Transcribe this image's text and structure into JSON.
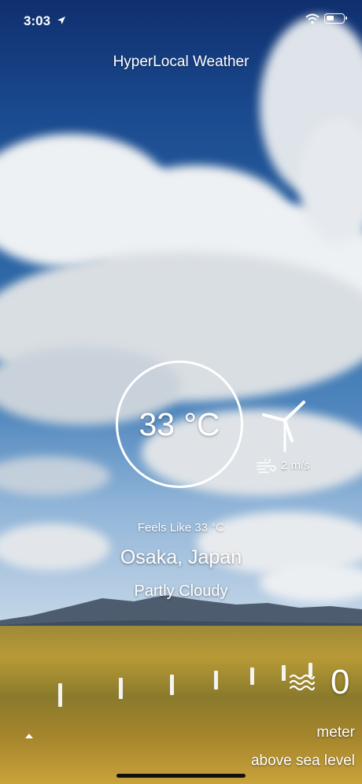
{
  "status_bar": {
    "time": "3:03"
  },
  "app": {
    "title": "HyperLocal Weather"
  },
  "weather": {
    "temperature": "33 °C",
    "wind_speed": "2 m/s",
    "feels_like": "Feels Like 33  °C",
    "location": "Osaka, Japan",
    "condition": "Partly Cloudy"
  },
  "elevation": {
    "value": "0",
    "unit": "meter",
    "reference": "above sea level"
  },
  "icons": [
    "location-arrow-icon",
    "wifi-icon",
    "battery-icon",
    "wind-turbine-icon",
    "wind-icon",
    "water-waves-icon",
    "chevron-up-icon"
  ]
}
